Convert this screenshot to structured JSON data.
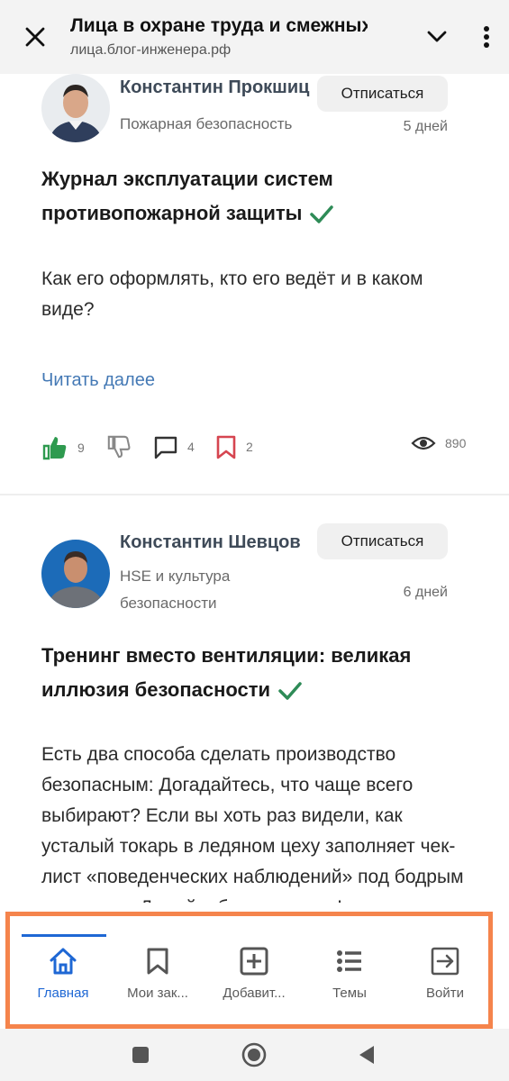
{
  "browser": {
    "title": "Лица в охране труда и смежных",
    "url": "лица.блог-инженера.рф"
  },
  "posts": [
    {
      "author": "Константин Прокшиц",
      "topic": "Пожарная безопасность",
      "unsubscribe_label": "Отписаться",
      "age": "5 дней",
      "title": "Журнал эксплуатации систем противопожарной защиты",
      "excerpt": "Как его оформлять, кто его ведёт и в каком виде?",
      "read_more": "Читать далее",
      "likes": "9",
      "comments": "4",
      "bookmarks": "2",
      "views": "890"
    },
    {
      "author": "Константин Шевцов",
      "topic": "HSE и культура безопасности",
      "unsubscribe_label": "Отписаться",
      "age": "6 дней",
      "title": "Тренинг вместо вентиляции: великая иллюзия безопасности",
      "excerpt": "Есть два способа сделать производство безопасным: Догадайтесь, что чаще всего выбирают? Если вы хоть раз видели, как усталый токарь в ледяном цеху заполняет чек-лист «поведенческих наблюдений» под бодрым плакатом «Думай о безопасности!»"
    }
  ],
  "bottom_nav": {
    "items": [
      {
        "label": "Главная",
        "icon": "home-icon"
      },
      {
        "label": "Мои зак...",
        "icon": "bookmark-icon"
      },
      {
        "label": "Добавит...",
        "icon": "add-box-icon"
      },
      {
        "label": "Темы",
        "icon": "list-icon"
      },
      {
        "label": "Войти",
        "icon": "login-icon"
      }
    ]
  },
  "colors": {
    "accent": "#1e67d4",
    "link": "#4479b5",
    "like_green": "#2e9a4f",
    "bookmark_red": "#d64550",
    "check_green": "#2e8b57",
    "highlight": "#f5844c"
  }
}
